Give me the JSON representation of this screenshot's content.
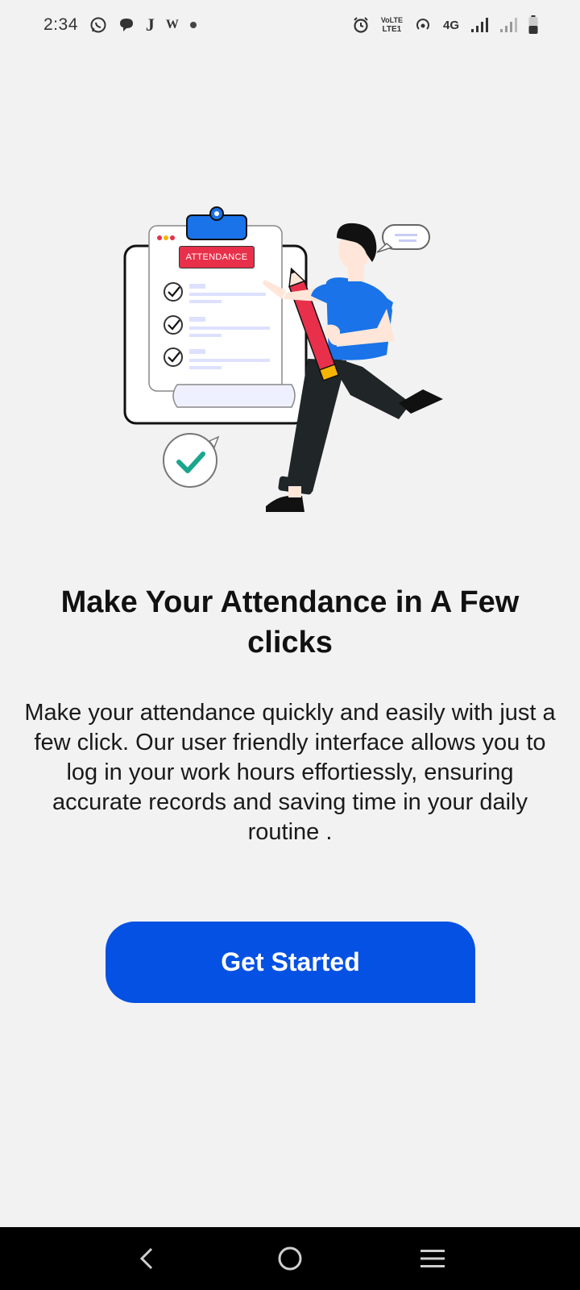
{
  "status_bar": {
    "time": "2:34",
    "left_icons": [
      "whatsapp-icon",
      "chat-bubble-icon",
      "j-app-icon",
      "w-app-icon",
      "notification-dot-icon"
    ],
    "right_icons": [
      "alarm-icon",
      "volte-icon",
      "hotspot-icon",
      "signal-4g-icon",
      "signal-icon",
      "battery-icon"
    ],
    "volte_text_top": "VoLTE",
    "volte_text_bottom": "LTE1",
    "network_label": "4G",
    "j_label": "J",
    "w_label": "W"
  },
  "illustration": {
    "clipboard_badge": "ATTENDANCE"
  },
  "onboarding": {
    "title": "Make Your Attendance in A Few clicks",
    "description": "Make your attendance quickly and easily with just a few click. Our user friendly interface allows you to log in your work hours effortiessly, ensuring accurate records and saving time in your daily routine .",
    "cta_label": "Get Started"
  },
  "colors": {
    "accent": "#0551e3",
    "badge": "#e8304a",
    "background": "#f2f2f3"
  },
  "nav_bar": {
    "buttons": [
      "back-icon",
      "home-icon",
      "recents-icon"
    ]
  }
}
